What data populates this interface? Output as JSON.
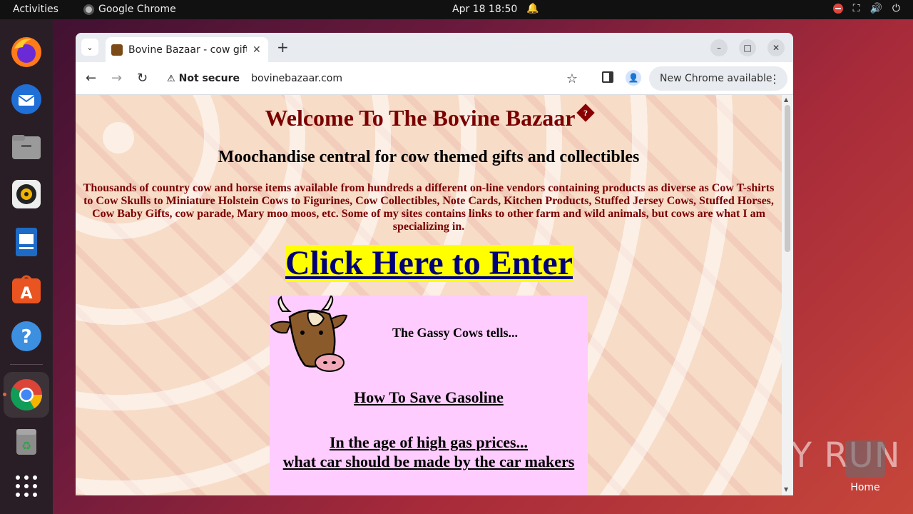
{
  "topbar": {
    "activities": "Activities",
    "app_name": "Google Chrome",
    "datetime": "Apr 18  18:50"
  },
  "dock": {
    "items": [
      "firefox-icon",
      "thunderbird-icon",
      "files-icon",
      "rhythmbox-icon",
      "writer-icon",
      "app-center-icon",
      "help-icon",
      "chrome-icon",
      "trash-icon",
      "apps-grid-icon"
    ]
  },
  "desktop": {
    "home_label": "Home",
    "watermark": "ANY RUN"
  },
  "browser": {
    "tab_title": "Bovine Bazaar - cow gifts",
    "omnibox_security": "Not secure",
    "url": "bovinebazaar.com",
    "update_label": "New Chrome available"
  },
  "webpage": {
    "heading": "Welcome To The Bovine Bazaar",
    "badge": "?",
    "subheading": "Moochandise central for cow themed gifts and collectibles",
    "intro": "Thousands of country cow and horse items available from hundreds a different on-line vendors containing  products as diverse as Cow T-shirts to Cow Skulls to Miniature Holstein Cows to Figurines, Cow Collectibles, Note Cards, Kitchen Products, Stuffed Jersey Cows, Stuffed Horses, Cow Baby Gifts, cow parade, Mary moo moos, etc.  Some of my sites contains links to other farm and wild animals, but cows are what I am specializing in.",
    "enter_link": "Click Here to Enter",
    "box": {
      "tells": "The Gassy Cows tells...",
      "save_title": "How To Save Gasoline",
      "age_line1": "In the age of high gas prices...",
      "age_line2": "what car should be made by the car makers"
    }
  },
  "colors": {
    "page_bg": "#f7dcc7",
    "heading": "#7a0000",
    "link": "#00007a",
    "link_highlight": "#ffff00",
    "box_bg": "#ffccff"
  }
}
